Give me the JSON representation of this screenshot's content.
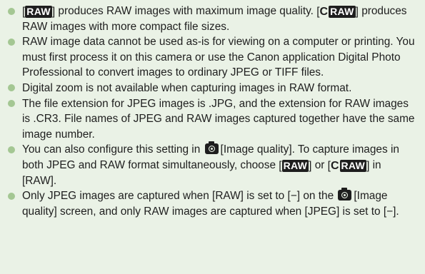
{
  "icons": {
    "raw": "RAW",
    "craw_prefix": "C",
    "craw": "RAW",
    "camera": "camera-icon"
  },
  "notes": [
    {
      "a": "produces RAW images with maximum image quality.",
      "b": "produces RAW images with more compact file sizes."
    },
    {
      "text": "RAW image data cannot be used as-is for viewing on a computer or printing. You must first process it on this camera or use the Canon application Digital Photo Professional to convert images to ordinary JPEG or TIFF files."
    },
    {
      "text": "Digital zoom is not available when capturing images in RAW format."
    },
    {
      "text": "The file extension for JPEG images is .JPG, and the extension for RAW images is .CR3. File names of JPEG and RAW images captured together have the same image number."
    },
    {
      "a": "You can also configure this setting in",
      "b": "[Image quality]. To capture images in both JPEG and RAW format simultaneously, choose",
      "c": "or",
      "d": "in [RAW]."
    },
    {
      "a": "Only JPEG images are captured when [RAW] is set to [−] on the",
      "b": "[Image quality] screen, and only RAW images are captured when [JPEG] is set to [−]."
    }
  ],
  "colors": {
    "panel_background": "#eaf2e6",
    "bullet": "#a4c793",
    "text": "#1e1e1e"
  }
}
